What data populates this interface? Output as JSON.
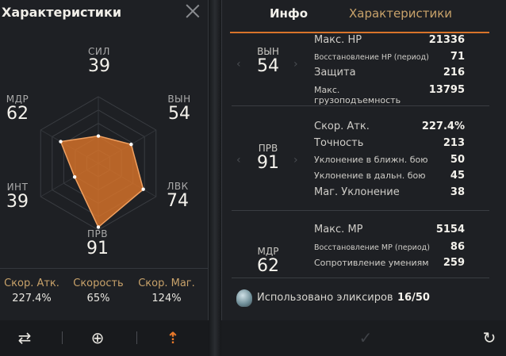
{
  "left": {
    "title": "Характеристики",
    "stats": [
      {
        "id": "sil",
        "label": "СИЛ",
        "value": "39"
      },
      {
        "id": "vyn",
        "label": "ВЫН",
        "value": "54"
      },
      {
        "id": "lvk",
        "label": "ЛВК",
        "value": "74"
      },
      {
        "id": "prv",
        "label": "ПРВ",
        "value": "91"
      },
      {
        "id": "int",
        "label": "ИНТ",
        "value": "39"
      },
      {
        "id": "mdr",
        "label": "МДР",
        "value": "62"
      }
    ],
    "secondary": [
      {
        "label": "Скор. Атк.",
        "value": "227.4%"
      },
      {
        "label": "Скорость",
        "value": "65%"
      },
      {
        "label": "Скор. Маг.",
        "value": "124%"
      }
    ],
    "toolbar": {
      "swap": "⇄",
      "zoom": "⊕",
      "upgrade": "⇡"
    },
    "accent": "#d9742a"
  },
  "right": {
    "tabs": [
      {
        "label": "Инфо",
        "active": true
      },
      {
        "label": "Характеристики",
        "active": false
      }
    ],
    "groups": [
      {
        "badge": "ВЫН",
        "value": "54",
        "rows": [
          {
            "k": "Макс. HP",
            "v": "21336",
            "size": "big"
          },
          {
            "k": "Восстановление HP (период)",
            "v": "71",
            "size": "small"
          },
          {
            "k": "Защита",
            "v": "216",
            "size": "big"
          },
          {
            "k": "Макс. грузоподъемность",
            "v": "13795",
            "size": "med"
          }
        ]
      },
      {
        "badge": "ПРВ",
        "value": "91",
        "rows": [
          {
            "k": "Скор. Атк.",
            "v": "227.4%",
            "size": "big"
          },
          {
            "k": "Точность",
            "v": "213",
            "size": "big"
          },
          {
            "k": "Уклонение в ближн. бою",
            "v": "50",
            "size": "med"
          },
          {
            "k": "Уклонение в дальн. бою",
            "v": "45",
            "size": "med"
          },
          {
            "k": "Маг. Уклонение",
            "v": "38",
            "size": "big"
          }
        ]
      },
      {
        "badge": "МДР",
        "value": "62",
        "rows": [
          {
            "k": "Макс. MP",
            "v": "5154",
            "size": "big"
          },
          {
            "k": "Восстановление MP (период)",
            "v": "86",
            "size": "small"
          },
          {
            "k": "Сопротивление умениям",
            "v": "259",
            "size": "med"
          }
        ]
      }
    ],
    "elixir": {
      "label": "Использовано эликсиров",
      "count": "16/50"
    },
    "confirm": "✓",
    "reset": "↻"
  }
}
